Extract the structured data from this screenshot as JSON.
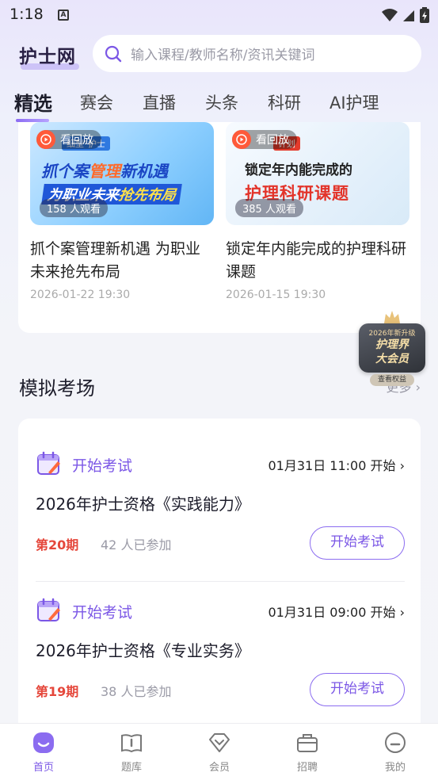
{
  "status_bar": {
    "time": "1:18",
    "notif_letter": "A"
  },
  "header": {
    "logo": "护士网",
    "search_placeholder": "输入课程/教师名称/资讯关键词"
  },
  "tabs": [
    "精选",
    "赛会",
    "直播",
    "头条",
    "科研",
    "AI护理"
  ],
  "videos": [
    {
      "badge": "看回放",
      "thumb_tag": "细型\"护士",
      "thumb_line1_a": "抓个案",
      "thumb_line1_b": "管理",
      "thumb_line1_c": "新机遇",
      "thumb_line2_a": "为职业未来",
      "thumb_line2_b": "抢先布局",
      "views": "158 人观看",
      "title": "抓个案管理新机遇 为职业未来抢先布局",
      "date": "2026-01-22 19:30"
    },
    {
      "badge": "看回放",
      "thumb_tag": "计划",
      "thumb_line1": "锁定年内能完成的",
      "thumb_line2": "护理科研课题",
      "views": "385 人观看",
      "title": "锁定年内能完成的护理科研课题",
      "date": "2026-01-15 19:30"
    }
  ],
  "vip_badge": {
    "top": "2026年新升级",
    "line1": "护理界",
    "line2": "大会员",
    "sub": "查看权益"
  },
  "section": {
    "title": "模拟考场",
    "more": "更多"
  },
  "exams": [
    {
      "status": "开始考试",
      "time": "01月31日 11:00 开始",
      "title": "2026年护士资格《实践能力》",
      "period": "第20期",
      "count": "42 人已参加",
      "button": "开始考试"
    },
    {
      "status": "开始考试",
      "time": "01月31日 09:00 开始",
      "title": "2026年护士资格《专业实务》",
      "period": "第19期",
      "count": "38 人已参加",
      "button": "开始考试"
    }
  ],
  "nav": [
    "首页",
    "题库",
    "会员",
    "招聘",
    "我的"
  ],
  "colors": {
    "accent": "#7b57e6",
    "period_red": "#e5473b",
    "replay_orange": "#ff5a3a"
  }
}
